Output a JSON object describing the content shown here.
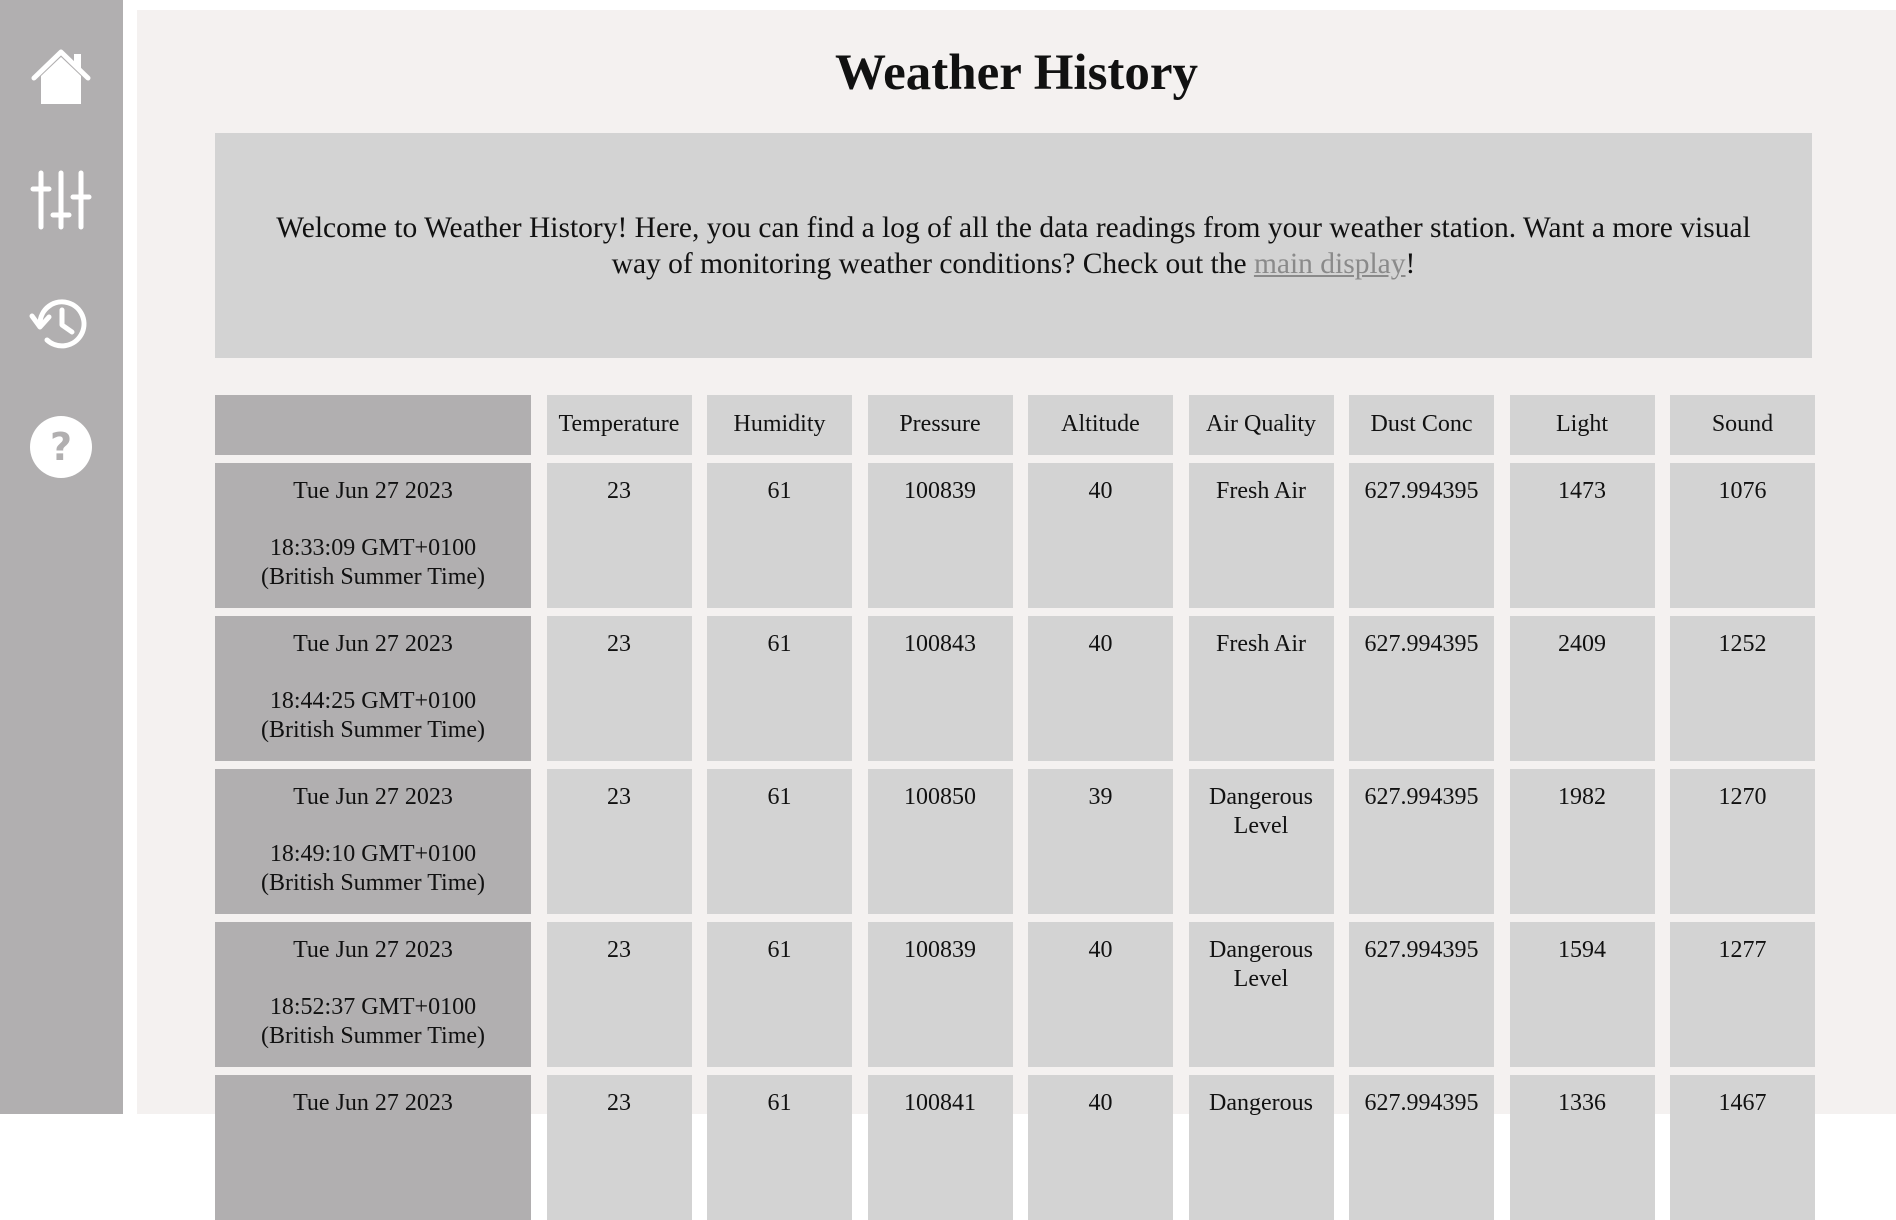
{
  "sidebar": {
    "items": [
      {
        "name": "home",
        "icon": "home-icon"
      },
      {
        "name": "settings",
        "icon": "sliders-icon"
      },
      {
        "name": "history",
        "icon": "history-icon"
      },
      {
        "name": "help",
        "icon": "help-icon"
      }
    ]
  },
  "page": {
    "title": "Weather History",
    "welcome_before": "Welcome to Weather History! Here, you can find a log of all the data readings from your weather station. Want a more visual way of monitoring weather conditions? Check out the ",
    "welcome_link": "main display",
    "welcome_after": "!"
  },
  "table": {
    "headers": [
      "Temperature",
      "Humidity",
      "Pressure",
      "Altitude",
      "Air Quality",
      "Dust Conc",
      "Light",
      "Sound"
    ],
    "rows": [
      {
        "date": "Tue Jun 27 2023",
        "time": "18:33:09 GMT+0100",
        "zone": "(British Summer Time)",
        "values": [
          "23",
          "61",
          "100839",
          "40",
          "Fresh Air",
          "627.994395",
          "1473",
          "1076"
        ]
      },
      {
        "date": "Tue Jun 27 2023",
        "time": "18:44:25 GMT+0100",
        "zone": "(British Summer Time)",
        "values": [
          "23",
          "61",
          "100843",
          "40",
          "Fresh Air",
          "627.994395",
          "2409",
          "1252"
        ]
      },
      {
        "date": "Tue Jun 27 2023",
        "time": "18:49:10 GMT+0100",
        "zone": "(British Summer Time)",
        "values": [
          "23",
          "61",
          "100850",
          "39",
          "Dangerous Level",
          "627.994395",
          "1982",
          "1270"
        ]
      },
      {
        "date": "Tue Jun 27 2023",
        "time": "18:52:37 GMT+0100",
        "zone": "(British Summer Time)",
        "values": [
          "23",
          "61",
          "100839",
          "40",
          "Dangerous Level",
          "627.994395",
          "1594",
          "1277"
        ]
      },
      {
        "date": "Tue Jun 27 2023",
        "time": "",
        "zone": "",
        "values": [
          "23",
          "61",
          "100841",
          "40",
          "Dangerous",
          "627.994395",
          "1336",
          "1467"
        ]
      }
    ]
  }
}
